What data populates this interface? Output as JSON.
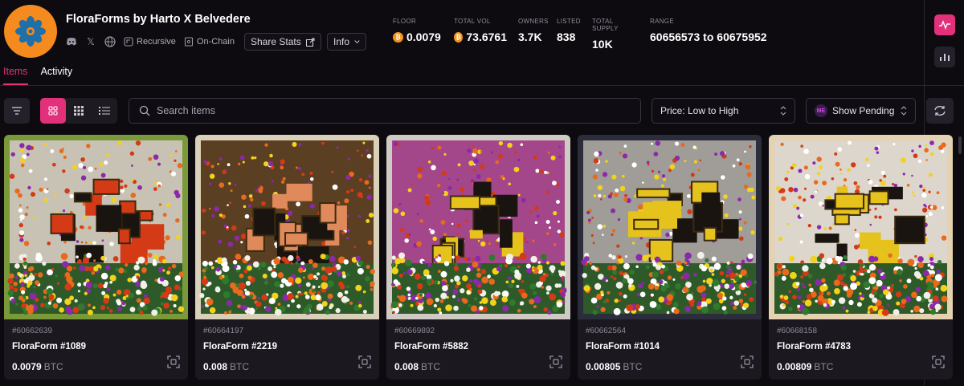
{
  "collection": {
    "title": "FloraForms by Harto X Belvedere",
    "tags": {
      "recursive": "Recursive",
      "on_chain": "On-Chain"
    },
    "share_label": "Share Stats",
    "info_label": "Info"
  },
  "stats": {
    "floor": {
      "label": "FLOOR",
      "value": "0.0079"
    },
    "total_vol": {
      "label": "TOTAL VOL",
      "value": "73.6761"
    },
    "owners": {
      "label": "OWNERS",
      "value": "3.7K"
    },
    "listed": {
      "label": "LISTED",
      "value": "838"
    },
    "total_supply": {
      "label": "TOTAL SUPPLY",
      "value": "10K"
    },
    "range": {
      "label": "RANGE",
      "value": "60656573 to 60675952"
    }
  },
  "tabs": [
    {
      "label": "Items",
      "active": true
    },
    {
      "label": "Activity",
      "active": false
    }
  ],
  "search": {
    "placeholder": "Search items"
  },
  "sort": {
    "value": "Price: Low to High"
  },
  "pending": {
    "label": "Show Pending",
    "badge": "ME"
  },
  "colors": {
    "accent": "#e2317a",
    "btc": "#f7931a",
    "brand_orange": "#f58a1f"
  },
  "cards": [
    {
      "id": "#60662639",
      "name": "FloraForm #1089",
      "price": "0.0079",
      "currency": "BTC",
      "bg": "#c8c2b4",
      "frame": "#7a9a3a",
      "theme": "#d43a16"
    },
    {
      "id": "#60664197",
      "name": "FloraForm #2219",
      "price": "0.008",
      "currency": "BTC",
      "bg": "#5a3f22",
      "frame": "#d8d0b8",
      "theme": "#e08a5c"
    },
    {
      "id": "#60669892",
      "name": "FloraForm #5882",
      "price": "0.008",
      "currency": "BTC",
      "bg": "#a4478a",
      "frame": "#cfcbc4",
      "theme": "#e6c21c"
    },
    {
      "id": "#60662564",
      "name": "FloraForm #1014",
      "price": "0.00805",
      "currency": "BTC",
      "bg": "#a09c98",
      "frame": "#2c2d3a",
      "theme": "#e6c21c"
    },
    {
      "id": "#60668158",
      "name": "FloraForm #4783",
      "price": "0.00809",
      "currency": "BTC",
      "bg": "#ddd6cc",
      "frame": "#e4d2b0",
      "theme": "#e6c21c"
    }
  ]
}
